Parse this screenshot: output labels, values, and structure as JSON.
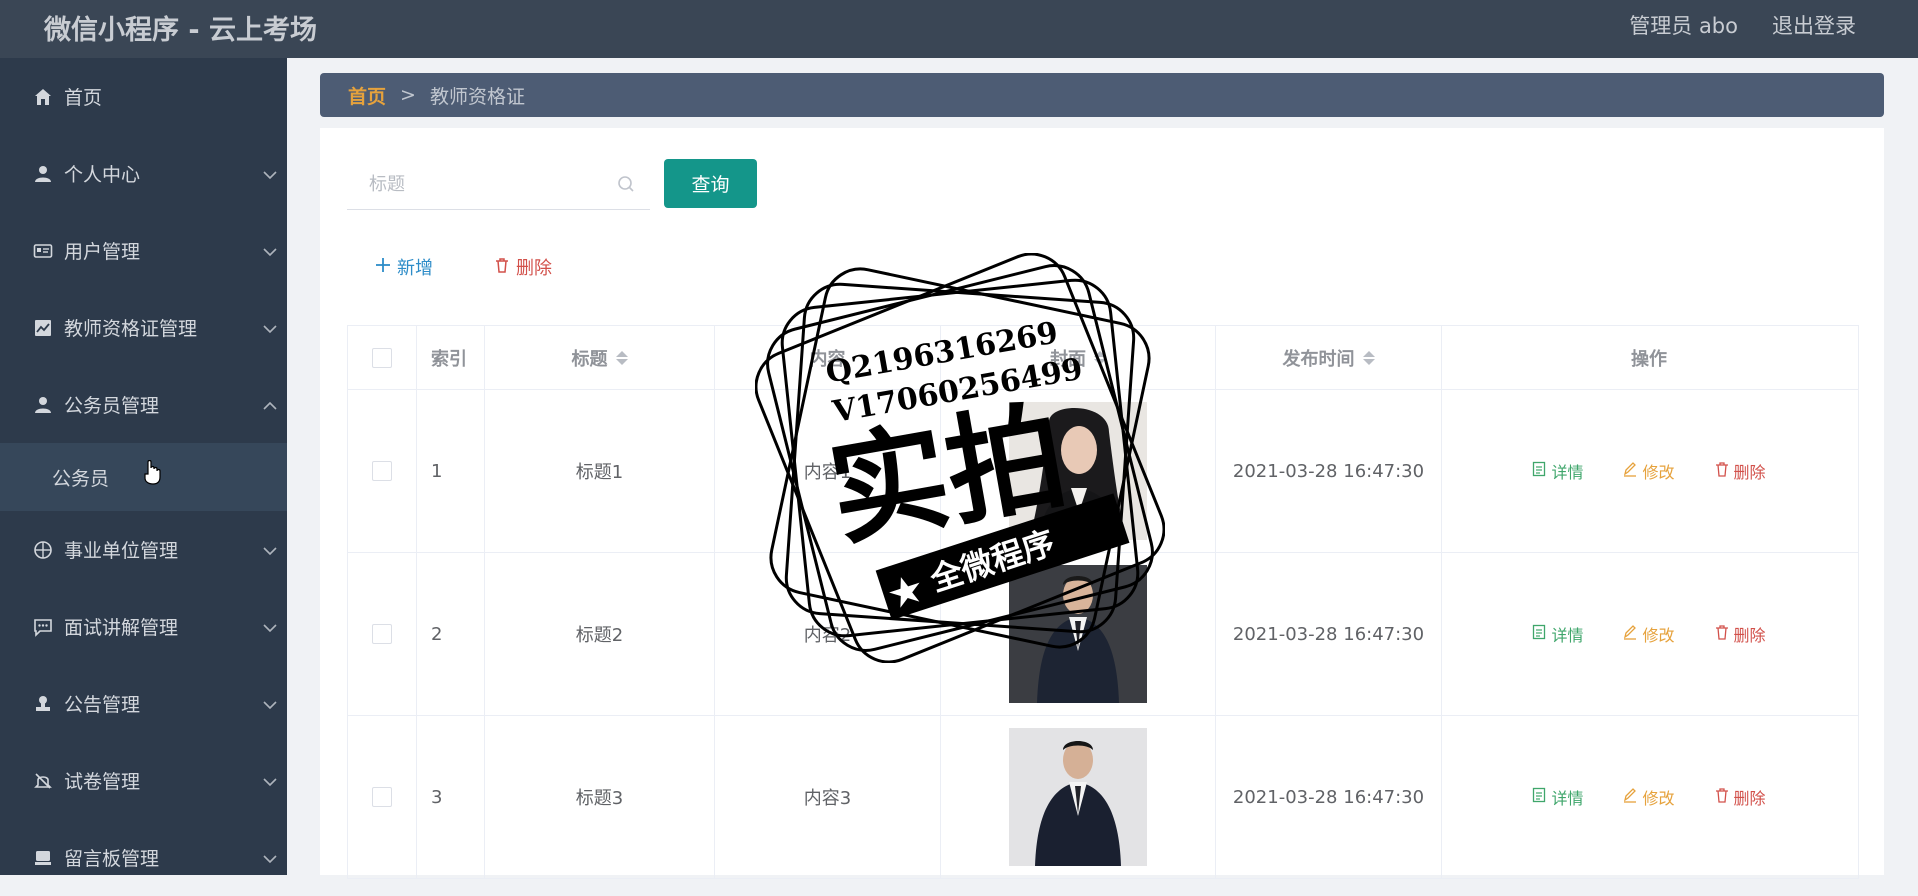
{
  "header": {
    "title": "微信小程序 - 云上考场",
    "user": "管理员 abo",
    "logout": "退出登录"
  },
  "sidebar": {
    "items": [
      {
        "label": "首页",
        "icon": "home-icon"
      },
      {
        "label": "个人中心",
        "icon": "user-icon"
      },
      {
        "label": "用户管理",
        "icon": "id-card-icon"
      },
      {
        "label": "教师资格证管理",
        "icon": "chart-icon"
      },
      {
        "label": "公务员管理",
        "icon": "user-icon"
      },
      {
        "label": "事业单位管理",
        "icon": "compass-icon"
      },
      {
        "label": "面试讲解管理",
        "icon": "message-icon"
      },
      {
        "label": "公告管理",
        "icon": "stamp-icon"
      },
      {
        "label": "试卷管理",
        "icon": "bell-off-icon"
      },
      {
        "label": "留言板管理",
        "icon": "board-icon"
      }
    ],
    "submenu": "公务员"
  },
  "breadcrumb": {
    "home": "首页",
    "separator": ">",
    "current": "教师资格证"
  },
  "search": {
    "placeholder": "标题",
    "button": "查询"
  },
  "actions": {
    "add": "新增",
    "delete": "删除"
  },
  "table": {
    "headers": [
      "索引",
      "标题",
      "内容",
      "封面",
      "发布时间",
      "操作"
    ],
    "rows": [
      {
        "index": "1",
        "title": "标题1",
        "content": "内容1",
        "time": "2021-03-28 16:47:30"
      },
      {
        "index": "2",
        "title": "标题2",
        "content": "内容2",
        "time": "2021-03-28 16:47:30"
      },
      {
        "index": "3",
        "title": "标题3",
        "content": "内容3",
        "time": "2021-03-28 16:47:30"
      }
    ],
    "ops": {
      "detail": "详情",
      "edit": "修改",
      "remove": "删除"
    }
  },
  "watermark": {
    "qq": "Q2196316269",
    "vx": "V17060256499",
    "big": "实拍",
    "band": "全微程序"
  },
  "colors": {
    "topbar": "#3a4655",
    "sidebar": "#2d3a4b",
    "accent": "#14968a",
    "crumb_home": "#e6a23c"
  }
}
